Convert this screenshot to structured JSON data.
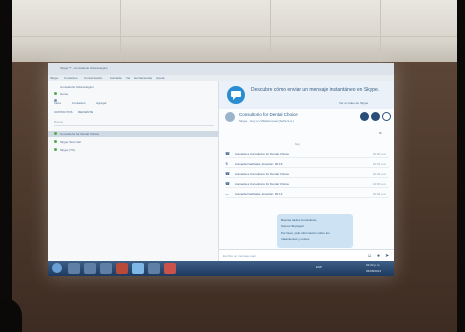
{
  "window": {
    "title": "Skype™ - Consultorio Odontologico",
    "menu": [
      "Skype",
      "Contactos",
      "Conversación",
      "Llamada",
      "Ver",
      "Herramientas",
      "Ayuda"
    ]
  },
  "sidebar": {
    "profile_name": "Consultorio Odontologico",
    "profile_status": "Home",
    "actions": [
      "Inicio",
      "Contactos",
      "Agregar"
    ],
    "tabs": [
      "CONTACTOS",
      "RECIENTE"
    ],
    "search_placeholder": "Buscar",
    "contacts": [
      {
        "name": "Consultorio for Dental Choice",
        "selected": true
      },
      {
        "name": "Skype Test Call",
        "selected": false
      },
      {
        "name": "Skype (TS)",
        "selected": false
      }
    ]
  },
  "banner": {
    "text": "Descubre cómo enviar un mensaje instantáneo en Skype.",
    "link": "Ver el vídeo de Skype"
  },
  "conversation": {
    "title": "Consultorio for Dental Choice",
    "subtitle": "Skype · Hoy en Villahermosa (Sofía S.A.)",
    "today_label": "hoy",
    "log": [
      {
        "icon": "phone",
        "text": "Llamada a Consultorio for Dental Choice",
        "time": "10:00 a.m."
      },
      {
        "icon": "phone-missed",
        "text": "Llamada finalizada, duración: 00:16",
        "time": "10:01 a.m."
      },
      {
        "icon": "phone",
        "text": "Llamada a Consultorio for Dental Choice",
        "time": "10:02 a.m."
      },
      {
        "icon": "phone",
        "text": "Llamada a Consultorio for Dental Choice",
        "time": "10:03 a.m."
      },
      {
        "icon": "hangup",
        "text": "Llamada finalizada, duración: 00:12",
        "time": "10:04 a.m."
      }
    ],
    "bubble_lines": [
      "Buenas tardes Consultorio,",
      "Somos SkyAgent",
      "Por favor, pido información sobre los",
      "tratamientos y costos"
    ],
    "compose_placeholder": "Escribe un mensaje aquí"
  },
  "taskbar": {
    "tray_text": "ESP",
    "clock": "02:34 p.m.",
    "date": "05/08/2014"
  }
}
